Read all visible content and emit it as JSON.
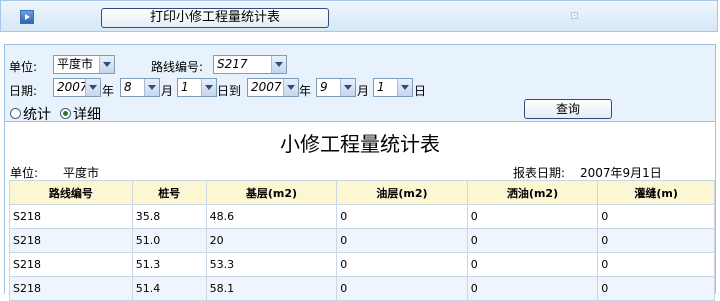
{
  "toolbar": {
    "print_label": "打印小修工程量统计表"
  },
  "filters": {
    "unit_label": "单位:",
    "unit_value": "平度市",
    "route_label": "路线编号:",
    "route_value": "S217",
    "date_label": "日期:",
    "start_year": "2007",
    "year_char": "年",
    "start_month": "8",
    "month_char": "月",
    "start_day": "1",
    "to_label": "日到",
    "end_year": "2007",
    "end_month": "9",
    "end_day": "1",
    "day_char": "日",
    "radio_summary": "统计",
    "radio_detail": "详细",
    "selected_mode": "详细",
    "query_label": "查询"
  },
  "report": {
    "title": "小修工程量统计表",
    "unit_label": "单位:",
    "unit_value": "平度市",
    "date_label": "报表日期:",
    "date_value": "2007年9月1日",
    "columns": [
      "路线编号",
      "桩号",
      "基层(m2)",
      "油层(m2)",
      "洒油(m2)",
      "灌缝(m)"
    ],
    "rows": [
      [
        "S218",
        "35.8",
        "48.6",
        "0",
        "0",
        "0"
      ],
      [
        "S218",
        "51.0",
        "20",
        "0",
        "0",
        "0"
      ],
      [
        "S218",
        "51.3",
        "53.3",
        "0",
        "0",
        "0"
      ],
      [
        "S218",
        "51.4",
        "58.1",
        "0",
        "0",
        "0"
      ]
    ]
  }
}
